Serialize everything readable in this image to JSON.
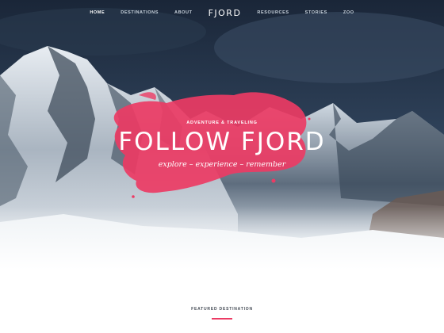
{
  "nav": {
    "items": [
      {
        "label": "HOME",
        "active": true
      },
      {
        "label": "DESTINATIONS",
        "active": false
      },
      {
        "label": "ABOUT",
        "active": false
      }
    ],
    "logo": "FJORD",
    "items_right": [
      {
        "label": "RESOURCES",
        "active": false
      },
      {
        "label": "STORIES",
        "active": false
      },
      {
        "label": "ZOO",
        "active": false
      }
    ]
  },
  "hero": {
    "kicker": "ADVENTURE & TRAVELING",
    "headline": "FOLLOW FJORD",
    "tagline": "explore – experience – remember"
  },
  "featured": {
    "label": "FEATURED DESTINATION"
  },
  "colors": {
    "accent": "#ec3b64",
    "sky": "#1c2b3d",
    "snow": "#ffffff"
  }
}
